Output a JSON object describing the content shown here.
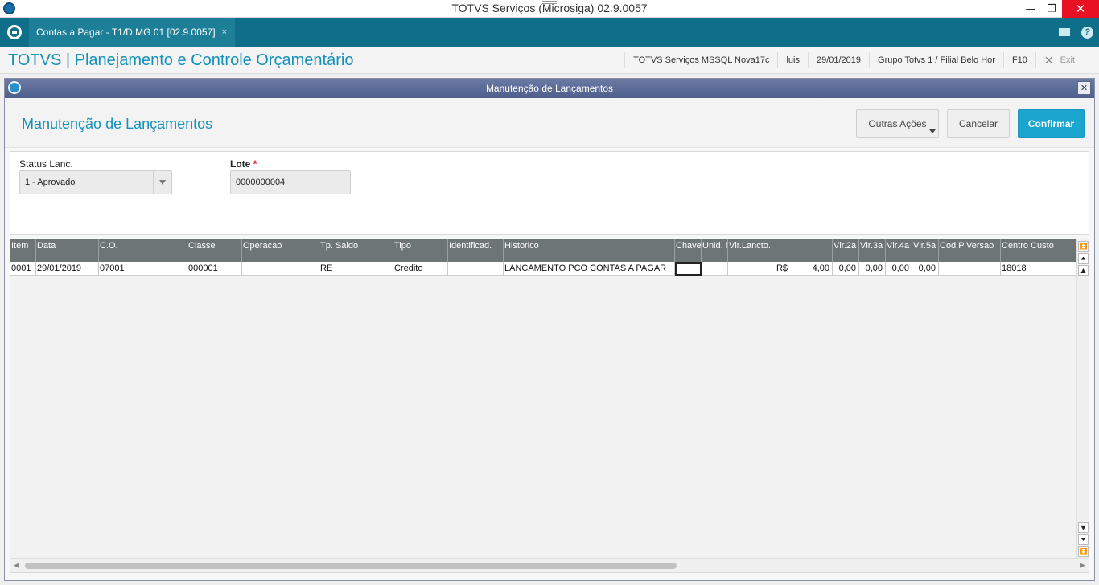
{
  "os": {
    "window_title": "TOTVS Serviços (Microsiga) 02.9.0057",
    "minimize": "—",
    "maximize": "❐",
    "close": "✕"
  },
  "tabbar": {
    "tab_label": "Contas a Pagar - T1/D MG 01  [02.9.0057]",
    "tab_close": "×",
    "icons": [
      "totvs-logo-icon",
      "mail-icon",
      "help-icon"
    ]
  },
  "header": {
    "app_title": "TOTVS | Planejamento e Controle Orçamentário",
    "environment": "TOTVS Serviços MSSQL Nova17c",
    "user": "luis",
    "date": "29/01/2019",
    "branch": "Grupo Totvs 1 / Filial Belo Hor",
    "shortcut": "F10",
    "exit_icon": "✕",
    "exit_label": "Exit"
  },
  "dialog": {
    "title": "Manutenção de Lançamentos",
    "close": "✕",
    "page_title": "Manutenção de Lançamentos",
    "buttons": {
      "outras": "Outras Ações",
      "cancelar": "Cancelar",
      "confirmar": "Confirmar"
    }
  },
  "form": {
    "status_label": "Status Lanc.",
    "status_value": "1 - Aprovado",
    "lote_label": "Lote",
    "lote_required": "*",
    "lote_value": "0000000004"
  },
  "grid": {
    "columns": [
      "Item",
      "Data",
      "C.O.",
      "Classe",
      "Operacao",
      "Tp. Saldo",
      "Tipo",
      "Identificad.",
      "Historico",
      "Chave",
      "Unid. M",
      "Vlr.Lancto.",
      "Vlr.2a",
      "Vlr.3a",
      "Vlr.4a",
      "Vlr.5a",
      "Cod.Pl",
      "Versao",
      "Centro Custo"
    ],
    "rows": [
      [
        "0001",
        "29/01/2019",
        "07001",
        "000001",
        "",
        "RE",
        "Credito",
        "",
        "LANCAMENTO PCO CONTAS A PAGAR",
        "",
        "",
        "R$          4,00",
        "0,00",
        "0,00",
        "0,00",
        "0,00",
        "",
        "",
        "18018"
      ]
    ]
  },
  "colors": {
    "tabbar": "#0f6f8a",
    "accent": "#1591b8",
    "confirm": "#1ba5cf",
    "grid_header": "#6e7577",
    "dialog_title": "#5a6893"
  }
}
